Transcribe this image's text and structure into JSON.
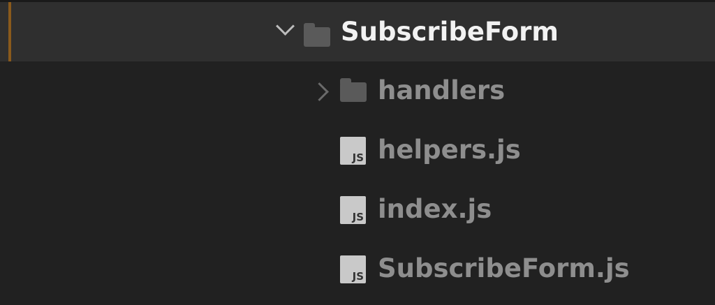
{
  "tree": {
    "root": {
      "label": "SubscribeForm",
      "icon": "folder-icon",
      "expanded": true,
      "selected": true
    },
    "children": [
      {
        "label": "handlers",
        "icon": "folder-icon",
        "expanded": false
      },
      {
        "label": "helpers.js",
        "icon": "js-file-icon",
        "badge": "JS"
      },
      {
        "label": "index.js",
        "icon": "js-file-icon",
        "badge": "JS"
      },
      {
        "label": "SubscribeForm.js",
        "icon": "js-file-icon",
        "badge": "JS"
      }
    ]
  },
  "colors": {
    "background": "#212121",
    "selected_row": "#2f2f2f",
    "accent": "#8a5a1c"
  }
}
